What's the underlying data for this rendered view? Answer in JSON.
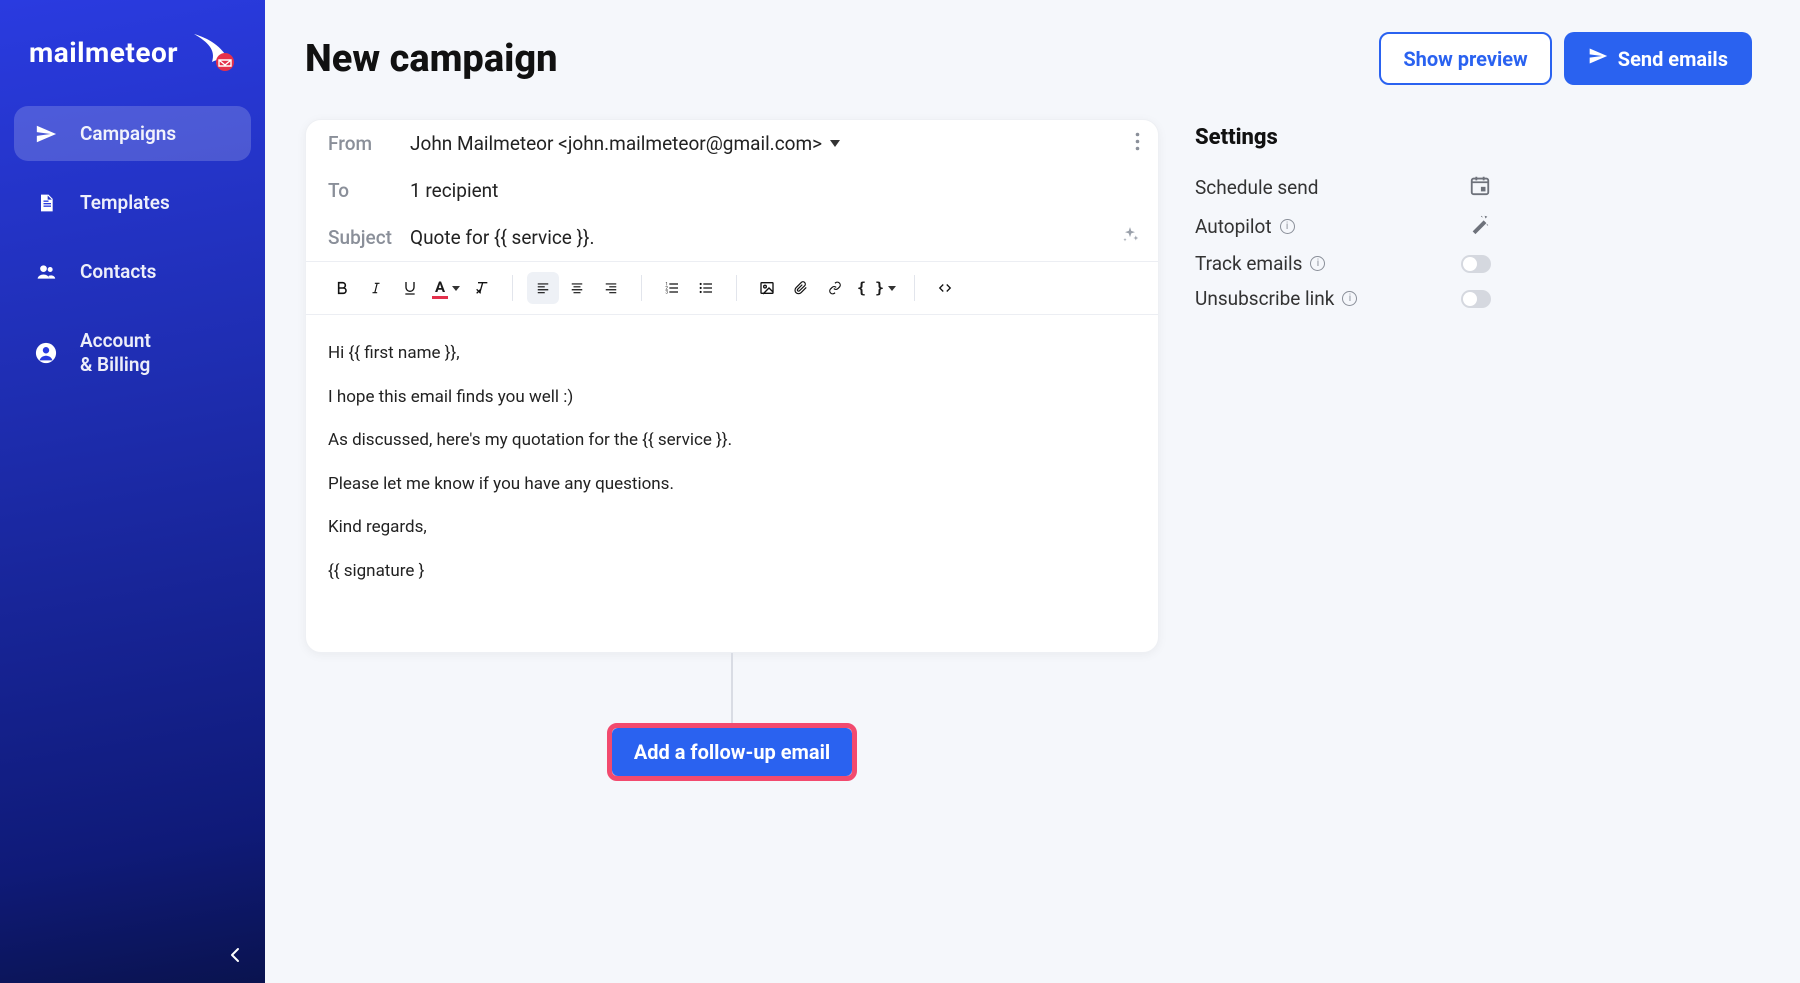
{
  "brand": {
    "name": "mailmeteor"
  },
  "sidebar": {
    "items": [
      {
        "label": "Campaigns",
        "active": true
      },
      {
        "label": "Templates"
      },
      {
        "label": "Contacts"
      },
      {
        "label": "Account\n& Billing"
      }
    ]
  },
  "header": {
    "title": "New campaign",
    "preview_label": "Show preview",
    "send_label": "Send emails"
  },
  "composer": {
    "from_label": "From",
    "from_value": "John Mailmeteor <john.mailmeteor@gmail.com>",
    "to_label": "To",
    "to_value": "1 recipient",
    "subject_label": "Subject",
    "subject_value": "Quote for {{ service }}.",
    "body_lines": [
      "Hi {{ first name }},",
      "I hope this email finds you well :)",
      "As discussed, here's my quotation for the {{ service }}.",
      "Please let me know if you have any questions.",
      "Kind regards,",
      "{{ signature }"
    ]
  },
  "followup": {
    "label": "Add a follow-up email"
  },
  "settings": {
    "title": "Settings",
    "rows": [
      {
        "label": "Schedule send",
        "control": "calendar"
      },
      {
        "label": "Autopilot",
        "info": true,
        "control": "wand"
      },
      {
        "label": "Track emails",
        "info": true,
        "control": "toggle"
      },
      {
        "label": "Unsubscribe link",
        "info": true,
        "control": "toggle"
      }
    ]
  }
}
